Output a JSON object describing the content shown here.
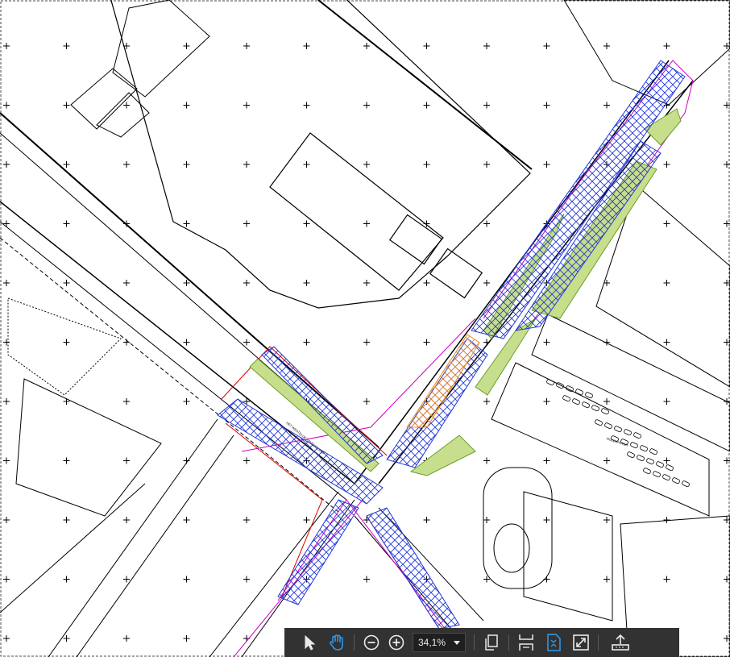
{
  "map": {
    "street_labels": [
      "HET WESTELIJK HAVENEILAND",
      "VIOLENHAVEN"
    ]
  },
  "toolbar": {
    "select_tool": "select-tool-icon",
    "hand_tool": "hand-tool-icon",
    "zoom_out": "zoom-out-icon",
    "zoom_in": "zoom-in-icon",
    "zoom_value": "34,1%",
    "page_mode": "page-view-icon",
    "fit_width": "fit-width-icon",
    "fit_page": "fit-page-icon",
    "fullscreen": "fullscreen-icon",
    "share": "share-icon",
    "active_color": "#2f9bef"
  }
}
